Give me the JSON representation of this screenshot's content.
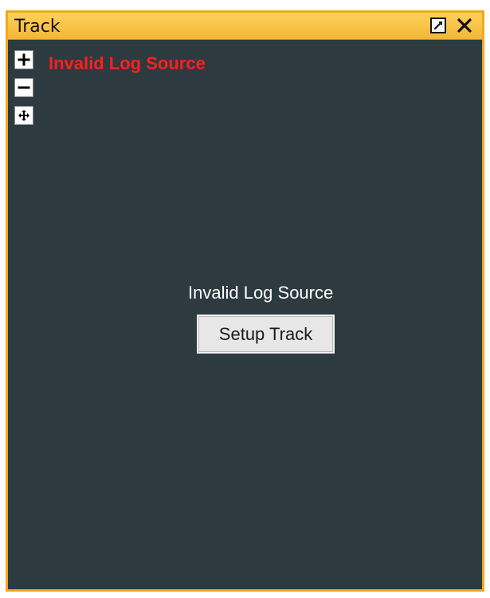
{
  "window": {
    "title": "Track"
  },
  "toolbar": {
    "buttons": [
      {
        "name": "zoom-in",
        "icon": "plus-icon"
      },
      {
        "name": "zoom-out",
        "icon": "minus-icon"
      },
      {
        "name": "pan",
        "icon": "move-arrows-icon"
      }
    ]
  },
  "status": {
    "header_error": "Invalid Log Source",
    "center_message": "Invalid Log Source"
  },
  "actions": {
    "setup_track_label": "Setup Track"
  },
  "colors": {
    "frame_border": "#f0a81e",
    "titlebar": "#f2b737",
    "panel_background": "#2d3a3f",
    "error_text": "#ff1f1f"
  }
}
